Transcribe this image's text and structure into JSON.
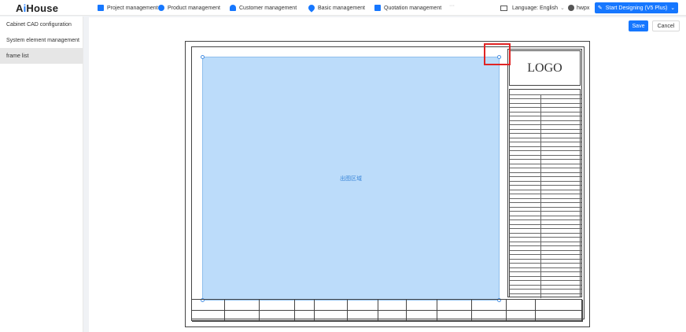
{
  "app": {
    "logo_prefix": "A",
    "logo_i": "i",
    "logo_suffix": "House"
  },
  "nav": {
    "items": [
      {
        "label": "Project management",
        "icon": "folder-icon",
        "color": "#1677ff"
      },
      {
        "label": "Product management",
        "icon": "gear-icon",
        "color": "#1677ff"
      },
      {
        "label": "Customer management",
        "icon": "user-icon",
        "color": "#1677ff"
      },
      {
        "label": "Basic management",
        "icon": "drop-icon",
        "color": "#1677ff"
      },
      {
        "label": "Quotation management",
        "icon": "document-icon",
        "color": "#1677ff"
      }
    ],
    "more": "···",
    "language_label": "Language: English",
    "user_name": "hwpx",
    "start_button": "Start Designing (V5 Plus)"
  },
  "sidebar": {
    "items": [
      {
        "label": "Cabinet CAD configuration",
        "active": false
      },
      {
        "label": "System element management",
        "active": false
      },
      {
        "label": "frame list",
        "active": true
      }
    ]
  },
  "toolbar": {
    "save_label": "Save",
    "cancel_label": "Cancel"
  },
  "frame": {
    "drawing_label": "出图区域",
    "logo_text": "LOGO"
  },
  "colors": {
    "accent": "#1677ff",
    "drawing_fill": "#bcdcfa",
    "highlight": "#e02424"
  }
}
